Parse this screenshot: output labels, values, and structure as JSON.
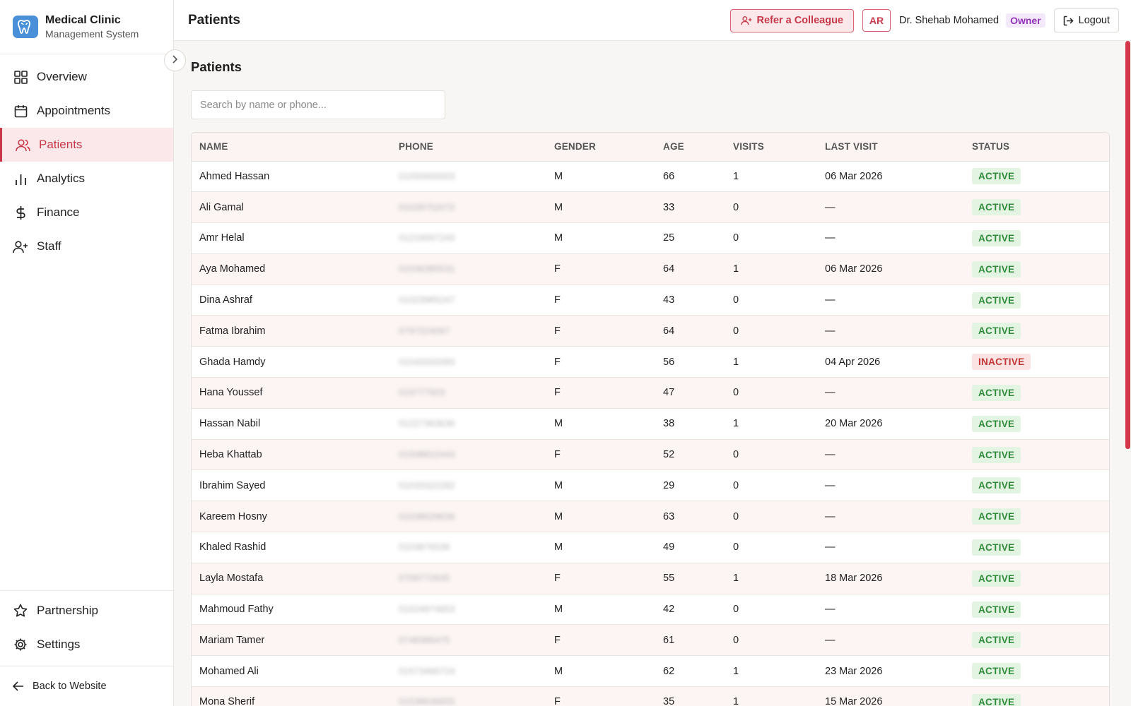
{
  "brand": {
    "title": "Medical Clinic",
    "subtitle": "Management System",
    "logo_color": "#4a90d9"
  },
  "sidebar": {
    "items": [
      {
        "label": "Overview",
        "icon": "grid-icon",
        "active": false
      },
      {
        "label": "Appointments",
        "icon": "calendar-icon",
        "active": false
      },
      {
        "label": "Patients",
        "icon": "users-icon",
        "active": true
      },
      {
        "label": "Analytics",
        "icon": "bar-chart-icon",
        "active": false
      },
      {
        "label": "Finance",
        "icon": "dollar-icon",
        "active": false
      },
      {
        "label": "Staff",
        "icon": "user-plus-icon",
        "active": false
      }
    ],
    "bottom_items": [
      {
        "label": "Partnership",
        "icon": "star-icon"
      },
      {
        "label": "Settings",
        "icon": "gear-icon"
      }
    ],
    "back_label": "Back to Website"
  },
  "header": {
    "title": "Patients",
    "refer_label": "Refer a Colleague",
    "lang_label": "AR",
    "user_name": "Dr. Shehab Mohamed",
    "role": "Owner",
    "logout_label": "Logout"
  },
  "main": {
    "title": "Patients",
    "search_placeholder": "Search by name or phone..."
  },
  "table": {
    "columns": [
      "NAME",
      "PHONE",
      "GENDER",
      "AGE",
      "VISITS",
      "LAST VISIT",
      "STATUS"
    ],
    "rows": [
      {
        "name": "Ahmed Hassan",
        "phone": "01050000003",
        "gender": "M",
        "age": "66",
        "visits": "1",
        "last_visit": "06 Mar 2026",
        "status": "ACTIVE"
      },
      {
        "name": "Ali Gamal",
        "phone": "01028752072",
        "gender": "M",
        "age": "33",
        "visits": "0",
        "last_visit": "—",
        "status": "ACTIVE"
      },
      {
        "name": "Amr Helal",
        "phone": "01216697243",
        "gender": "M",
        "age": "25",
        "visits": "0",
        "last_visit": "—",
        "status": "ACTIVE"
      },
      {
        "name": "Aya Mohamed",
        "phone": "01536385531",
        "gender": "F",
        "age": "64",
        "visits": "1",
        "last_visit": "06 Mar 2026",
        "status": "ACTIVE"
      },
      {
        "name": "Dina Ashraf",
        "phone": "01023985247",
        "gender": "F",
        "age": "43",
        "visits": "0",
        "last_visit": "—",
        "status": "ACTIVE"
      },
      {
        "name": "Fatma Ibrahim",
        "phone": "0797224067",
        "gender": "F",
        "age": "64",
        "visits": "0",
        "last_visit": "—",
        "status": "ACTIVE"
      },
      {
        "name": "Ghada Hamdy",
        "phone": "01543333393",
        "gender": "F",
        "age": "56",
        "visits": "1",
        "last_visit": "04 Apr 2026",
        "status": "INACTIVE"
      },
      {
        "name": "Hana Youssef",
        "phone": "019777923",
        "gender": "F",
        "age": "47",
        "visits": "0",
        "last_visit": "—",
        "status": "ACTIVE"
      },
      {
        "name": "Hassan Nabil",
        "phone": "01227363636",
        "gender": "M",
        "age": "38",
        "visits": "1",
        "last_visit": "20 Mar 2026",
        "status": "ACTIVE"
      },
      {
        "name": "Heba Khattab",
        "phone": "01508822443",
        "gender": "F",
        "age": "52",
        "visits": "0",
        "last_visit": "—",
        "status": "ACTIVE"
      },
      {
        "name": "Ibrahim Sayed",
        "phone": "01033322282",
        "gender": "M",
        "age": "29",
        "visits": "0",
        "last_visit": "—",
        "status": "ACTIVE"
      },
      {
        "name": "Kareem Hosny",
        "phone": "01038629636",
        "gender": "M",
        "age": "63",
        "visits": "0",
        "last_visit": "—",
        "status": "ACTIVE"
      },
      {
        "name": "Khaled Rashid",
        "phone": "0103876536",
        "gender": "M",
        "age": "49",
        "visits": "0",
        "last_visit": "—",
        "status": "ACTIVE"
      },
      {
        "name": "Layla Mostafa",
        "phone": "0708772635",
        "gender": "F",
        "age": "55",
        "visits": "1",
        "last_visit": "18 Mar 2026",
        "status": "ACTIVE"
      },
      {
        "name": "Mahmoud Fathy",
        "phone": "01024974653",
        "gender": "M",
        "age": "42",
        "visits": "0",
        "last_visit": "—",
        "status": "ACTIVE"
      },
      {
        "name": "Mariam Tamer",
        "phone": "0748386475",
        "gender": "F",
        "age": "61",
        "visits": "0",
        "last_visit": "—",
        "status": "ACTIVE"
      },
      {
        "name": "Mohamed Ali",
        "phone": "01573466724",
        "gender": "M",
        "age": "62",
        "visits": "1",
        "last_visit": "23 Mar 2026",
        "status": "ACTIVE"
      },
      {
        "name": "Mona Sherif",
        "phone": "01538636655",
        "gender": "F",
        "age": "35",
        "visits": "1",
        "last_visit": "15 Mar 2026",
        "status": "ACTIVE"
      }
    ]
  },
  "colors": {
    "accent": "#c8384b",
    "active_status": "#2f8a3a",
    "inactive_status": "#c23434",
    "role": "#9333ba"
  }
}
